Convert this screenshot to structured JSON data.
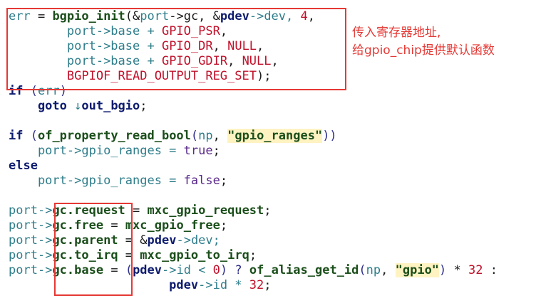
{
  "code": {
    "lines": [
      [
        {
          "t": "err",
          "c": "var"
        },
        {
          "t": " = ",
          "c": "op"
        },
        {
          "t": "bgpio_init",
          "c": "fn"
        },
        {
          "t": "(&",
          "c": "op"
        },
        {
          "t": "port",
          "c": "var"
        },
        {
          "t": "->gc, &",
          "c": "op"
        },
        {
          "t": "pdev",
          "c": "kw"
        },
        {
          "t": "->dev, ",
          "c": "var"
        },
        {
          "t": "4",
          "c": "num"
        },
        {
          "t": ",",
          "c": "op"
        }
      ],
      [
        {
          "t": "        port",
          "c": "var"
        },
        {
          "t": "->base + ",
          "c": "var"
        },
        {
          "t": "GPIO_PSR",
          "c": "mac"
        },
        {
          "t": ",",
          "c": "op"
        }
      ],
      [
        {
          "t": "        port",
          "c": "var"
        },
        {
          "t": "->base + ",
          "c": "var"
        },
        {
          "t": "GPIO_DR",
          "c": "mac"
        },
        {
          "t": ", ",
          "c": "op"
        },
        {
          "t": "NULL",
          "c": "mac"
        },
        {
          "t": ",",
          "c": "op"
        }
      ],
      [
        {
          "t": "        port",
          "c": "var"
        },
        {
          "t": "->base + ",
          "c": "var"
        },
        {
          "t": "GPIO_GDIR",
          "c": "mac"
        },
        {
          "t": ", ",
          "c": "op"
        },
        {
          "t": "NULL",
          "c": "mac"
        },
        {
          "t": ",",
          "c": "op"
        }
      ],
      [
        {
          "t": "        BGPIOF_READ_OUTPUT_REG_SET",
          "c": "mac"
        },
        {
          "t": ");",
          "c": "op"
        }
      ],
      [
        {
          "t": "if",
          "c": "kw"
        },
        {
          "t": " (",
          "c": "pl"
        },
        {
          "t": "err",
          "c": "var"
        },
        {
          "t": ")",
          "c": "pl"
        }
      ],
      [
        {
          "t": "    goto",
          "c": "kw"
        },
        {
          "t": " ↓",
          "c": "var"
        },
        {
          "t": "out_bgio",
          "c": "kw"
        },
        {
          "t": ";",
          "c": "op"
        }
      ],
      [
        {
          "t": "",
          "c": "op"
        }
      ],
      [
        {
          "t": "if",
          "c": "kw"
        },
        {
          "t": " (",
          "c": "pl"
        },
        {
          "t": "of_property_read_bool",
          "c": "fn"
        },
        {
          "t": "(",
          "c": "pl"
        },
        {
          "t": "np",
          "c": "var"
        },
        {
          "t": ", ",
          "c": "op"
        },
        {
          "t": "\"gpio_ranges\"",
          "c": "str"
        },
        {
          "t": "))",
          "c": "pl"
        }
      ],
      [
        {
          "t": "    port",
          "c": "var"
        },
        {
          "t": "->gpio_ranges = ",
          "c": "var"
        },
        {
          "t": "true",
          "c": "gr"
        },
        {
          "t": ";",
          "c": "op"
        }
      ],
      [
        {
          "t": "else",
          "c": "kw"
        }
      ],
      [
        {
          "t": "    port",
          "c": "var"
        },
        {
          "t": "->gpio_ranges = ",
          "c": "var"
        },
        {
          "t": "false",
          "c": "gr"
        },
        {
          "t": ";",
          "c": "op"
        }
      ],
      [
        {
          "t": "",
          "c": "op"
        }
      ],
      [
        {
          "t": "port",
          "c": "var"
        },
        {
          "t": "->",
          "c": "var"
        },
        {
          "t": "gc.request",
          "c": "fn"
        },
        {
          "t": " = ",
          "c": "op"
        },
        {
          "t": "mxc_gpio_request",
          "c": "fn"
        },
        {
          "t": ";",
          "c": "op"
        }
      ],
      [
        {
          "t": "port",
          "c": "var"
        },
        {
          "t": "->",
          "c": "var"
        },
        {
          "t": "gc.free",
          "c": "fn"
        },
        {
          "t": " = ",
          "c": "op"
        },
        {
          "t": "mxc_gpio_free",
          "c": "fn"
        },
        {
          "t": ";",
          "c": "op"
        }
      ],
      [
        {
          "t": "port",
          "c": "var"
        },
        {
          "t": "->",
          "c": "var"
        },
        {
          "t": "gc.parent",
          "c": "fn"
        },
        {
          "t": " = &",
          "c": "op"
        },
        {
          "t": "pdev",
          "c": "kw"
        },
        {
          "t": "->dev;",
          "c": "var"
        }
      ],
      [
        {
          "t": "port",
          "c": "var"
        },
        {
          "t": "->",
          "c": "var"
        },
        {
          "t": "gc.to_irq",
          "c": "fn"
        },
        {
          "t": " = ",
          "c": "op"
        },
        {
          "t": "mxc_gpio_to_irq",
          "c": "fn"
        },
        {
          "t": ";",
          "c": "op"
        }
      ],
      [
        {
          "t": "port",
          "c": "var"
        },
        {
          "t": "->",
          "c": "var"
        },
        {
          "t": "gc.base",
          "c": "fn"
        },
        {
          "t": " = ",
          "c": "op"
        },
        {
          "t": "(",
          "c": "pl"
        },
        {
          "t": "pdev",
          "c": "kw"
        },
        {
          "t": "->id < ",
          "c": "var"
        },
        {
          "t": "0",
          "c": "num"
        },
        {
          "t": ") ? ",
          "c": "pl"
        },
        {
          "t": "of_alias_get_id",
          "c": "fn"
        },
        {
          "t": "(",
          "c": "pl"
        },
        {
          "t": "np",
          "c": "var"
        },
        {
          "t": ", ",
          "c": "op"
        },
        {
          "t": "\"gpio\"",
          "c": "str"
        },
        {
          "t": ")",
          "c": "pl"
        },
        {
          "t": " * ",
          "c": "op"
        },
        {
          "t": "32",
          "c": "num"
        },
        {
          "t": " :",
          "c": "op"
        }
      ],
      [
        {
          "t": "                      pdev",
          "c": "kw"
        },
        {
          "t": "->id * ",
          "c": "var"
        },
        {
          "t": "32",
          "c": "num"
        },
        {
          "t": ";",
          "c": "op"
        }
      ]
    ]
  },
  "annotation": {
    "line1": "传入寄存器地址,",
    "line2": "给gpio_chip提供默认函数"
  },
  "colors": {
    "highlight_box": "#e53935",
    "annotation_text": "#e53935"
  }
}
